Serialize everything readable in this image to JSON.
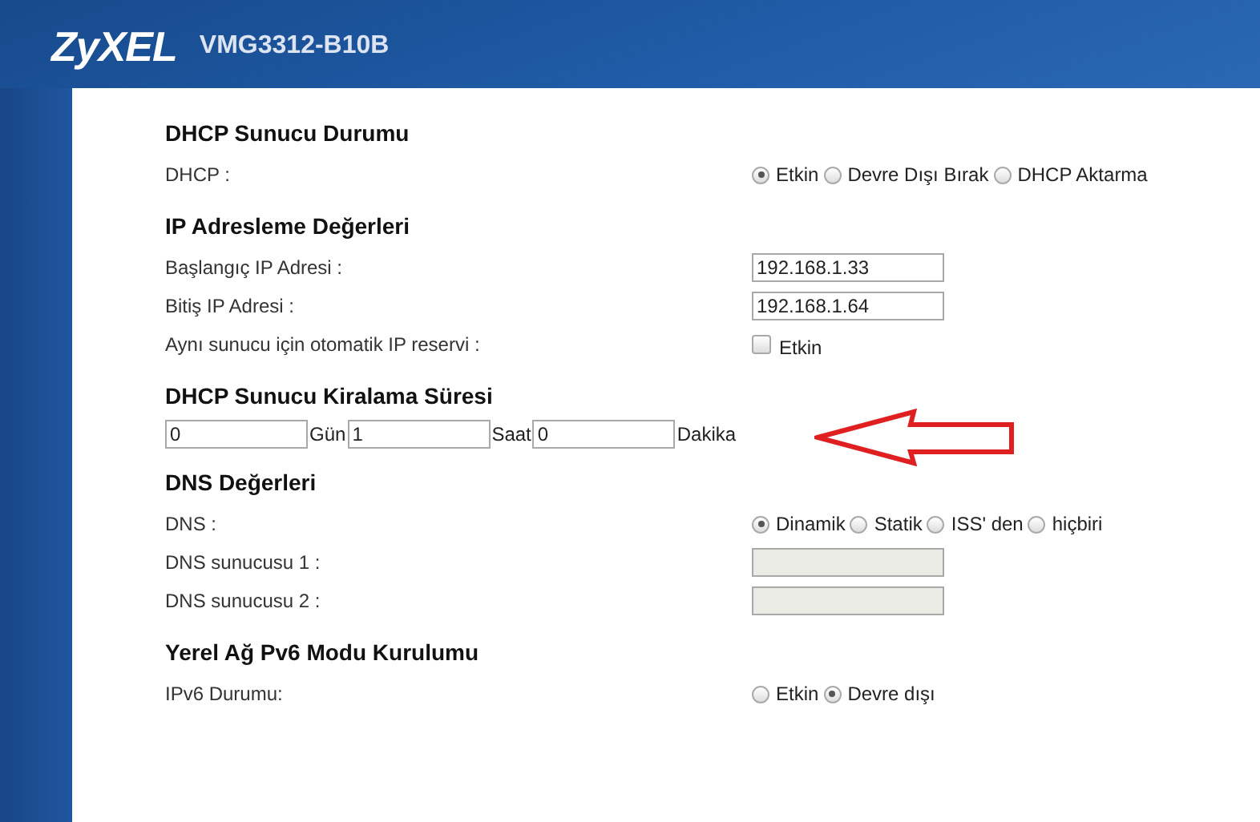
{
  "header": {
    "logo": "ZyXEL",
    "model": "VMG3312-B10B"
  },
  "sections": [
    {
      "title": "DHCP Sunucu Durumu",
      "rows": [
        {
          "kind": "radio",
          "label": "DHCP :",
          "options": [
            {
              "label": "Etkin",
              "selected": true
            },
            {
              "label": "Devre Dışı Bırak",
              "selected": false
            },
            {
              "label": "DHCP Aktarma",
              "selected": false
            }
          ]
        }
      ]
    },
    {
      "title": "IP Adresleme Değerleri",
      "rows": [
        {
          "kind": "text",
          "label": "Başlangıç IP Adresi :",
          "value": "192.168.1.33",
          "disabled": false
        },
        {
          "kind": "text",
          "label": "Bitiş IP Adresi :",
          "value": "192.168.1.64",
          "disabled": false
        },
        {
          "kind": "checkbox",
          "label": "Aynı sunucu için otomatik IP reservi :",
          "option": "Etkin",
          "checked": false
        }
      ]
    },
    {
      "title": "DHCP Sunucu Kiralama Süresi",
      "rows": [
        {
          "kind": "lease",
          "fields": [
            {
              "value": "0",
              "unit": "Gün"
            },
            {
              "value": "1",
              "unit": "Saat"
            },
            {
              "value": "0",
              "unit": "Dakika"
            }
          ]
        }
      ]
    },
    {
      "title": "DNS Değerleri",
      "rows": [
        {
          "kind": "radio",
          "label": "DNS :",
          "options": [
            {
              "label": "Dinamik",
              "selected": true
            },
            {
              "label": "Statik",
              "selected": false
            },
            {
              "label": "ISS' den",
              "selected": false
            },
            {
              "label": "hiçbiri",
              "selected": false
            }
          ]
        },
        {
          "kind": "text",
          "label": "DNS sunucusu 1 :",
          "disabled": true
        },
        {
          "kind": "text",
          "label": "DNS sunucusu 2 :",
          "disabled": true
        }
      ]
    },
    {
      "title": "Yerel Ağ Pv6 Modu Kurulumu",
      "rows": [
        {
          "kind": "radio",
          "label": "IPv6 Durumu:",
          "options": [
            {
              "label": "Etkin",
              "selected": false
            },
            {
              "label": "Devre dışı",
              "selected": true
            }
          ]
        }
      ]
    }
  ]
}
